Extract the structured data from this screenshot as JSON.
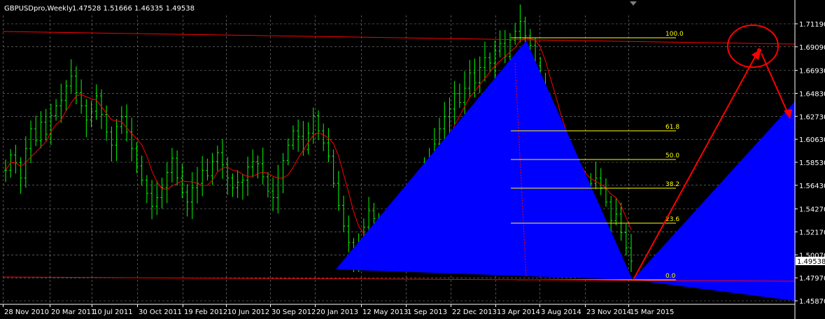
{
  "header": {
    "symbol": "GBPUSDpro,Weekly",
    "ohlc": "1.47528 1.51666 1.46335 1.49538"
  },
  "chart_data": {
    "type": "candlestick-bars",
    "symbol": "GBPUSDpro",
    "timeframe": "Weekly",
    "y_ticks": [
      1.7119,
      1.6909,
      1.6693,
      1.6483,
      1.6273,
      1.6063,
      1.5853,
      1.5643,
      1.5427,
      1.5217,
      1.5007,
      1.4797,
      1.4587
    ],
    "y_tick_labels": [
      "1.71190",
      "1.69090",
      "1.66930",
      "1.64830",
      "1.62730",
      "1.60630",
      "1.58530",
      "1.56430",
      "1.54270",
      "1.52170",
      "1.50070",
      "1.47970",
      "1.45870"
    ],
    "ylim": [
      1.455,
      1.725
    ],
    "current_price": "1.49538",
    "x_tick_labels": [
      "28 Nov 2010",
      "20 Mar 2011",
      "10 Jul 2011",
      "30 Oct 2011",
      "19 Feb 2012",
      "10 Jun 2012",
      "30 Sep 2012",
      "20 Jan 2013",
      "12 May 2013",
      "1 Sep 2013",
      "22 Dec 2013",
      "13 Apr 2014",
      "3 Aug 2014",
      "23 Nov 2014",
      "15 Mar 2015"
    ],
    "price_series_close": [
      1.578,
      1.592,
      1.585,
      1.571,
      1.598,
      1.616,
      1.605,
      1.622,
      1.611,
      1.628,
      1.637,
      1.642,
      1.655,
      1.664,
      1.649,
      1.637,
      1.624,
      1.632,
      1.646,
      1.629,
      1.613,
      1.601,
      1.618,
      1.627,
      1.613,
      1.598,
      1.582,
      1.569,
      1.557,
      1.545,
      1.553,
      1.562,
      1.576,
      1.589,
      1.571,
      1.558,
      1.549,
      1.562,
      1.566,
      1.578,
      1.573,
      1.586,
      1.594,
      1.583,
      1.571,
      1.562,
      1.567,
      1.569,
      1.581,
      1.586,
      1.584,
      1.572,
      1.559,
      1.553,
      1.571,
      1.587,
      1.601,
      1.614,
      1.609,
      1.597,
      1.612,
      1.628,
      1.614,
      1.603,
      1.591,
      1.566,
      1.546,
      1.527,
      1.512,
      1.498,
      1.511,
      1.526,
      1.541,
      1.534,
      1.52,
      1.505,
      1.518,
      1.532,
      1.545,
      1.529,
      1.538,
      1.551,
      1.561,
      1.575,
      1.589,
      1.602,
      1.616,
      1.627,
      1.634,
      1.648,
      1.64,
      1.653,
      1.667,
      1.658,
      1.672,
      1.681,
      1.676,
      1.687,
      1.694,
      1.682,
      1.697,
      1.705,
      1.714,
      1.701,
      1.692,
      1.674,
      1.656,
      1.633,
      1.618,
      1.607,
      1.592,
      1.588,
      1.577,
      1.572,
      1.564,
      1.557,
      1.566,
      1.571,
      1.562,
      1.549,
      1.532,
      1.538,
      1.521,
      1.507,
      1.495
    ],
    "moving_average": "red line",
    "fibonacci_levels": [
      {
        "label": "100.0",
        "value": 1.7025
      },
      {
        "label": "61.8",
        "value": 1.614
      },
      {
        "label": "50.0",
        "value": 1.592
      },
      {
        "label": "38.2",
        "value": 1.562
      },
      {
        "label": "23.6",
        "value": 1.532
      },
      {
        "label": "0.0",
        "value": 1.483
      }
    ],
    "trend_lines": [
      {
        "name": "upper",
        "color": "#ff0000"
      },
      {
        "name": "lower",
        "color": "#ff0000"
      }
    ],
    "annotations": [
      "blue triangles (harmonic pattern)",
      "red arrows projection",
      "red ellipse target"
    ],
    "grid": true,
    "colors": {
      "background": "#000000",
      "bars": "#00ff00",
      "ma": "#ff0000",
      "pattern": "#0000ff",
      "fib": "#ffff00",
      "grid": "#c0c0c0"
    }
  }
}
